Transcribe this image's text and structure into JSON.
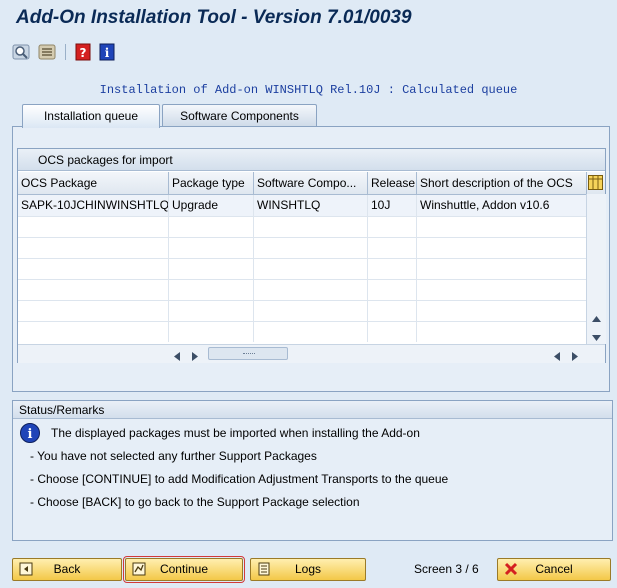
{
  "window": {
    "title": "Add-On Installation Tool - Version 7.01/0039"
  },
  "toolbar": {
    "icons": [
      "find-icon",
      "settings-icon",
      "help-icon",
      "info-icon"
    ]
  },
  "heading": "Installation of Add-on WINSHTLQ Rel.10J : Calculated queue",
  "tabs": [
    {
      "label": "Installation queue",
      "active": true
    },
    {
      "label": "Software Components",
      "active": false
    }
  ],
  "table": {
    "title": "OCS packages for import",
    "columns": [
      "OCS Package",
      "Package type",
      "Software Compo...",
      "Release",
      "Short description of the OCS"
    ],
    "rows": [
      [
        "SAPK-10JCHINWINSHTLQ",
        "Upgrade",
        "WINSHTLQ",
        "10J",
        "Winshuttle, Addon v10.6"
      ]
    ]
  },
  "status": {
    "title": "Status/Remarks",
    "message": "The displayed packages must be imported when installing the Add-on",
    "lines": [
      "- You have not selected any further Support Packages",
      "- Choose [CONTINUE] to add Modification Adjustment Transports to the queue",
      "- Choose [BACK] to go back to the Support Package selection"
    ]
  },
  "buttons": {
    "back": "Back",
    "continue": "Continue",
    "logs": "Logs",
    "cancel": "Cancel"
  },
  "screen_indicator": "Screen 3 / 6",
  "colors": {
    "accent": "#f3c848",
    "title": "#0a2a56",
    "heading": "#1c3fa0",
    "background": "#dfeaf5"
  }
}
